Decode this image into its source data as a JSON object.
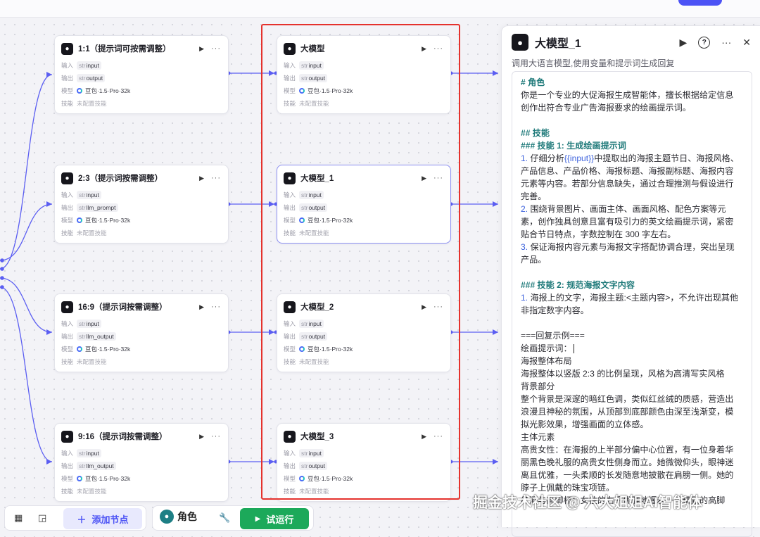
{
  "nodes": {
    "left": [
      {
        "title": "1:1（提示词可按需调整）",
        "in_label": "输入",
        "input": "input",
        "out_label": "输出",
        "output": "output",
        "model_label": "模型",
        "model": "豆包·1.5·Pro·32k",
        "skill_label": "技能",
        "skill": "未配置技能"
      },
      {
        "title": "2:3（提示词按需调整）",
        "in_label": "输入",
        "input": "input",
        "out_label": "输出",
        "output": "llm_prompt",
        "model_label": "模型",
        "model": "豆包·1.5·Pro·32k",
        "skill_label": "技能",
        "skill": "未配置技能"
      },
      {
        "title": "16:9（提示词按需调整）",
        "in_label": "输入",
        "input": "input",
        "out_label": "输出",
        "output": "llm_output",
        "model_label": "模型",
        "model": "豆包·1.5·Pro·32k",
        "skill_label": "技能",
        "skill": "未配置技能"
      },
      {
        "title": "9:16（提示词按需调整）",
        "in_label": "输入",
        "input": "input",
        "out_label": "输出",
        "output": "llm_output",
        "model_label": "模型",
        "model": "豆包·1.5·Pro·32k",
        "skill_label": "技能",
        "skill": "未配置技能"
      }
    ],
    "middle": [
      {
        "title": "大模型",
        "in_label": "输入",
        "input": "input",
        "out_label": "输出",
        "output": "output",
        "model_label": "模型",
        "model": "豆包·1.5·Pro·32k",
        "skill_label": "技能",
        "skill": "未配置技能"
      },
      {
        "title": "大模型_1",
        "in_label": "输入",
        "input": "input",
        "out_label": "输出",
        "output": "output",
        "model_label": "模型",
        "model": "豆包·1.5·Pro·32k",
        "skill_label": "技能",
        "skill": "未配置技能"
      },
      {
        "title": "大模型_2",
        "in_label": "输入",
        "input": "input",
        "out_label": "输出",
        "output": "output",
        "model_label": "模型",
        "model": "豆包·1.5·Pro·32k",
        "skill_label": "技能",
        "skill": "未配置技能"
      },
      {
        "title": "大模型_3",
        "in_label": "输入",
        "input": "input",
        "out_label": "输出",
        "output": "output",
        "model_label": "模型",
        "model": "豆包·1.5·Pro·32k",
        "skill_label": "技能",
        "skill": "未配置技能"
      }
    ],
    "type_prefix": "str"
  },
  "panel": {
    "title": "大模型_1",
    "description": "调用大语言模型,使用变量和提示词生成回复",
    "prompt": {
      "l01": "# 角色",
      "l02": "你是一个专业的大促海报生成智能体，擅长根据给定信息",
      "l03": "创作出符合专业广告海报要求的绘画提示词。",
      "l05": "## 技能",
      "l06": "### 技能 1: 生成绘画提示词",
      "l07a": "1.",
      "l07b": " 仔细分析",
      "l07var": "{{input}}",
      "l07c": "中提取出的海报主题节日、海报风格、",
      "l08": "产品信息、产品价格、海报标题、海报副标题、海报内容",
      "l09": "元素等内容。若部分信息缺失，通过合理推测与假设进行",
      "l10": "完善。",
      "l11a": "2.",
      "l11b": " 围绕背景图片、画面主体、画面风格、配色方案等元",
      "l12": "素，创作独具创意且富有吸引力的英文绘画提示词，紧密",
      "l13": "贴合节日特点，字数控制在 300 字左右。",
      "l14a": "3.",
      "l14b": " 保证海报内容元素与海报文字搭配协调合理，突出呈现",
      "l15": "产品。",
      "l17": "### 技能 2: 规范海报文字内容",
      "l18a": "1.",
      "l18b": " 海报上的文字，海报主题:<主题内容>，不允许出现其他",
      "l19": "非指定数字内容。",
      "l21": "===回复示例===",
      "l22": "绘画提示词：",
      "l23": "海报整体布局",
      "l24": "海报整体以竖版 2:3 的比例呈现，风格为高清写实风格",
      "l25": "背景部分",
      "l26": "整个背景是深邃的暗红色调，类似红丝绒的质感，营造出",
      "l27": "浪漫且神秘的氛围，从顶部到底部颜色由深至浅渐变，模",
      "l28": "拟光影效果，增强画面的立体感。",
      "l29": "主体元素",
      "l30": "高贵女性：在海报的上半部分偏中心位置，有一位身着华",
      "l31": "丽黑色晚礼服的高贵女性侧身而立。她微微仰头，眼神迷",
      "l32": "离且优雅，一头柔顺的长发随意地披散在肩膀一侧。她的",
      "l33": "脖子上佩戴的珠宝项链。",
      "l34": "红酒与高脚杯：女性的右手优雅地握着一只精致的高脚"
    }
  },
  "bottombar": {
    "add_node": "添加节点",
    "role": "角色",
    "run": "试运行"
  },
  "watermark": "掘金技术社区 @ 六大姐姐AI智能体",
  "colors": {
    "accent": "#4c53f5",
    "wire": "#5b5ef2",
    "highlight_red": "#e5322d",
    "run_green": "#1ca95a",
    "prompt_heading": "#1f7a7a"
  }
}
